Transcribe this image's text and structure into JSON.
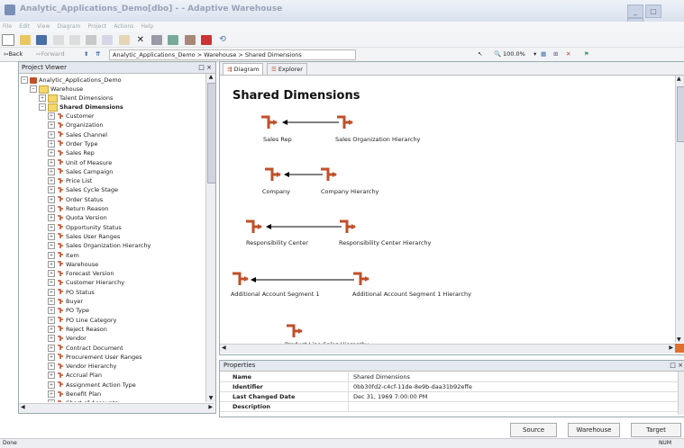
{
  "window": {
    "title": "Analytic_Applications_Demo[dbo] - - Adaptive Warehouse",
    "controls": [
      "_",
      "□",
      "×"
    ]
  },
  "menubar": [
    "File",
    "Edit",
    "View",
    "Diagram",
    "Project",
    "Actions",
    "Help"
  ],
  "nav": {
    "back": "Back",
    "forward": "Forward",
    "breadcrumb": "Analytic_Applications_Demo > Warehouse > Shared Dimensions",
    "zoom": "100.0%"
  },
  "project_viewer": {
    "title": "Project Viewer",
    "close": "□ ×",
    "tree": {
      "root": "Analytic_Applications_Demo",
      "warehouse": "Warehouse",
      "talent": "Talent Dimensions",
      "shared": "Shared Dimensions",
      "items": [
        "Customer",
        "Organization",
        "Sales Channel",
        "Order Type",
        "Sales Rep",
        "Unit of Measure",
        "Sales Campaign",
        "Price List",
        "Sales Cycle Stage",
        "Order Status",
        "Return Reason",
        "Quota Version",
        "Opportunity Status",
        "Sales User Ranges",
        "Sales Organization Hierarchy",
        "Item",
        "Warehouse",
        "Forecast Version",
        "Customer Hierarchy",
        "PO Status",
        "Buyer",
        "PO Type",
        "PO Line Category",
        "Reject Reason",
        "Vendor",
        "Contract Document",
        "Procurement User Ranges",
        "Vendor Hierarchy",
        "Accrual Plan",
        "Assignment Action Type",
        "Benefit Plan",
        "Chart of Accounts"
      ]
    }
  },
  "diagram": {
    "tabs": [
      "Diagram",
      "Explorer"
    ],
    "title": "Shared Dimensions",
    "nodes": {
      "sales_rep": "Sales Rep",
      "sales_org_h": "Sales Organization Hierarchy",
      "company": "Company",
      "company_h": "Company Hierarchy",
      "resp_center": "Responsibility Center",
      "resp_center_h": "Responsibility Center Hierarchy",
      "acct_seg1": "Additional Account Segment 1",
      "acct_seg1_h": "Additional Account Segment 1 Hierarchy",
      "product_line_h": "Product Line Sales Hierarchy"
    }
  },
  "properties": {
    "title": "Properties",
    "close": "□ ×",
    "rows": [
      {
        "key": "Name",
        "value": "Shared Dimensions"
      },
      {
        "key": "Identifier",
        "value": "0bb30fd2-c4cf-11de-8e9b-daa31b92effe"
      },
      {
        "key": "Last Changed Date",
        "value": "Dec 31, 1969 7:00:00 PM"
      },
      {
        "key": "Description",
        "value": ""
      }
    ]
  },
  "buttons": {
    "source": "Source",
    "warehouse": "Warehouse",
    "target": "Target"
  },
  "status": {
    "left": "Done",
    "right": "NUM"
  },
  "colors": {
    "dim_icon": "#c0502a",
    "accent": "#3a6ea5"
  }
}
